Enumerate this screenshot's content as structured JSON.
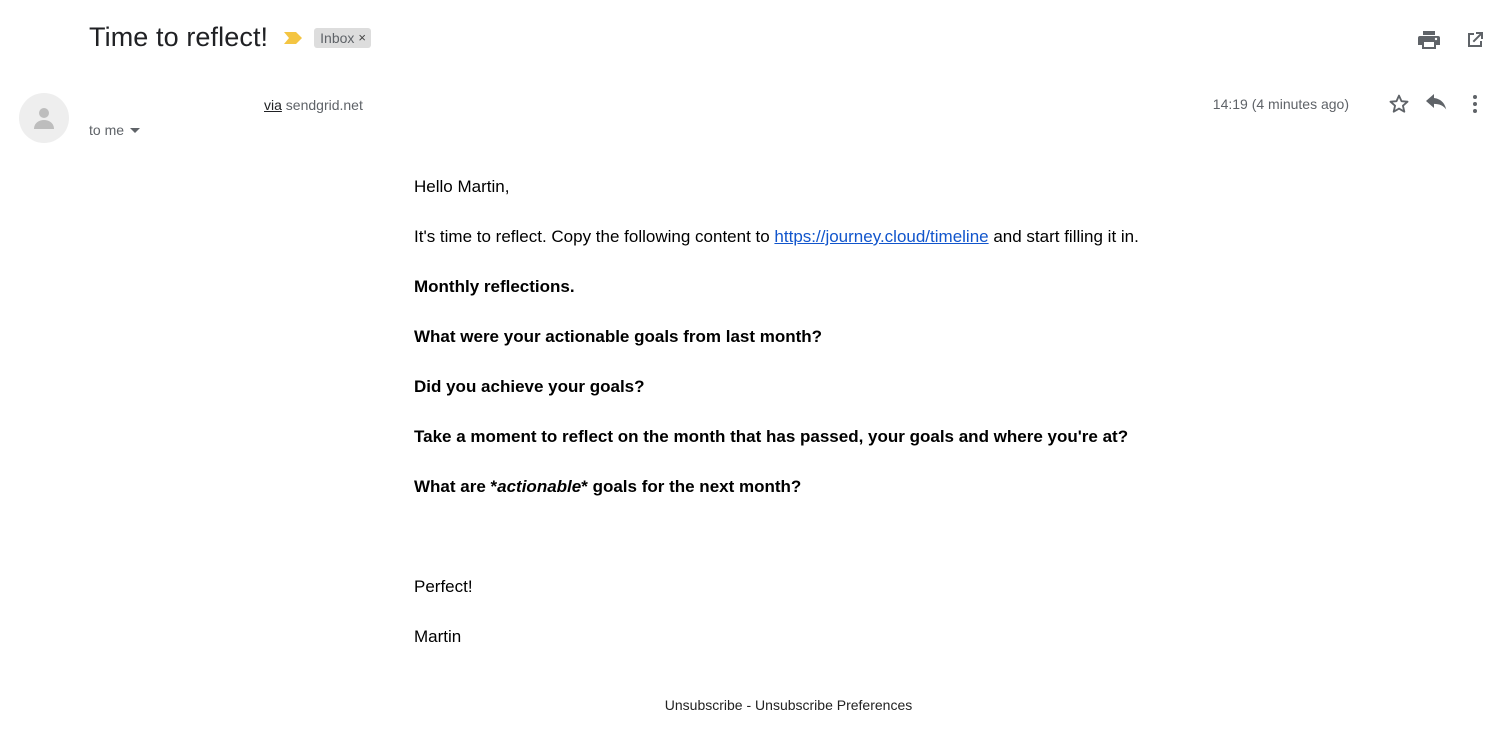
{
  "subject": {
    "title": "Time to reflect!",
    "label_chip": "Inbox",
    "label_close": "×"
  },
  "sender": {
    "via_label": "via",
    "domain": "sendgrid.net",
    "to": "to me",
    "timestamp": "14:19 (4 minutes ago)"
  },
  "body": {
    "greeting": "Hello Martin,",
    "intro_before": "It's time to reflect. Copy the following content to ",
    "intro_link": "https://journey.cloud/timeline",
    "intro_after": " and start filling it in.",
    "q1": "Monthly reflections.",
    "q2": "What were your actionable goals from last month?",
    "q3": "Did you achieve your goals?",
    "q4": "Take a moment to reflect on the month that has passed, your goals and where you're at?",
    "q5_before": "What are *",
    "q5_italic": "actionable",
    "q5_after": "* goals for the next month?",
    "closing": "Perfect!",
    "signature": "Martin"
  },
  "footer": {
    "unsubscribe": "Unsubscribe",
    "separator": " - ",
    "preferences": "Unsubscribe Preferences"
  },
  "colors": {
    "importance": "#f4c542",
    "link": "#1155cc",
    "icon": "#5f6368"
  }
}
